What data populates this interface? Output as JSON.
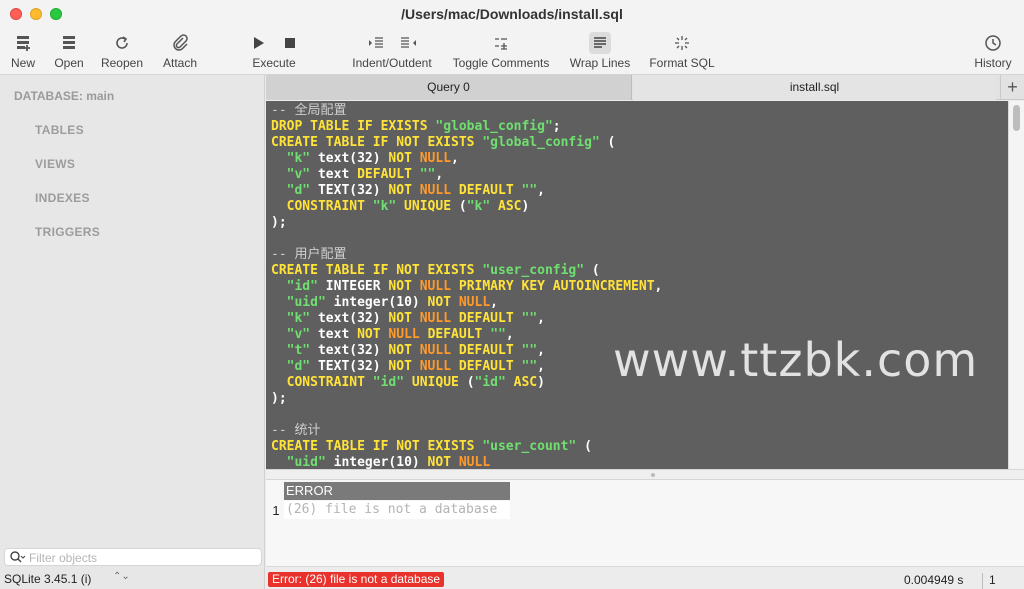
{
  "window": {
    "title": "/Users/mac/Downloads/install.sql"
  },
  "toolbar": {
    "new": "New",
    "open": "Open",
    "reopen": "Reopen",
    "attach": "Attach",
    "execute": "Execute",
    "indent_outdent": "Indent/Outdent",
    "toggle_comments": "Toggle Comments",
    "wrap_lines": "Wrap Lines",
    "format_sql": "Format SQL",
    "history": "History"
  },
  "sidebar": {
    "database_label": "DATABASE: main",
    "items": [
      "TABLES",
      "VIEWS",
      "INDEXES",
      "TRIGGERS"
    ],
    "filter_placeholder": "Filter objects",
    "sqlite_version": "SQLite 3.45.1 (i)",
    "version_chevron": "⌃⌄"
  },
  "tabs": [
    "Query 0",
    "install.sql"
  ],
  "tab_add": "+",
  "editor": {
    "watermark": "www.ttzbk.com",
    "lines": [
      [
        [
          "c",
          "-- 全局配置"
        ]
      ],
      [
        [
          "k",
          "DROP TABLE IF EXISTS "
        ],
        [
          "s",
          "\"global_config\""
        ],
        [
          "p",
          ";"
        ]
      ],
      [
        [
          "k",
          "CREATE TABLE IF NOT EXISTS "
        ],
        [
          "s",
          "\"global_config\""
        ],
        [
          "p",
          " ("
        ]
      ],
      [
        [
          "p",
          "  "
        ],
        [
          "s",
          "\"k\""
        ],
        [
          "p",
          " text(32) "
        ],
        [
          "k",
          "NOT "
        ],
        [
          "n",
          "NULL"
        ],
        [
          "p",
          ","
        ]
      ],
      [
        [
          "p",
          "  "
        ],
        [
          "s",
          "\"v\""
        ],
        [
          "p",
          " text "
        ],
        [
          "k",
          "DEFAULT "
        ],
        [
          "s",
          "\"\""
        ],
        [
          "p",
          ","
        ]
      ],
      [
        [
          "p",
          "  "
        ],
        [
          "s",
          "\"d\""
        ],
        [
          "p",
          " TEXT(32) "
        ],
        [
          "k",
          "NOT "
        ],
        [
          "n",
          "NULL "
        ],
        [
          "k",
          "DEFAULT "
        ],
        [
          "s",
          "\"\""
        ],
        [
          "p",
          ","
        ]
      ],
      [
        [
          "p",
          "  "
        ],
        [
          "k",
          "CONSTRAINT "
        ],
        [
          "s",
          "\"k\""
        ],
        [
          "k",
          " UNIQUE "
        ],
        [
          "p",
          "("
        ],
        [
          "s",
          "\"k\""
        ],
        [
          "k",
          " ASC"
        ],
        [
          "p",
          ")"
        ]
      ],
      [
        [
          "p",
          ");"
        ]
      ],
      [
        [
          "p",
          ""
        ]
      ],
      [
        [
          "c",
          "-- 用户配置"
        ]
      ],
      [
        [
          "k",
          "CREATE TABLE IF NOT EXISTS "
        ],
        [
          "s",
          "\"user_config\""
        ],
        [
          "p",
          " ("
        ]
      ],
      [
        [
          "p",
          "  "
        ],
        [
          "s",
          "\"id\""
        ],
        [
          "p",
          " INTEGER "
        ],
        [
          "k",
          "NOT "
        ],
        [
          "n",
          "NULL "
        ],
        [
          "k",
          "PRIMARY KEY AUTOINCREMENT"
        ],
        [
          "p",
          ","
        ]
      ],
      [
        [
          "p",
          "  "
        ],
        [
          "s",
          "\"uid\""
        ],
        [
          "p",
          " integer(10) "
        ],
        [
          "k",
          "NOT "
        ],
        [
          "n",
          "NULL"
        ],
        [
          "p",
          ","
        ]
      ],
      [
        [
          "p",
          "  "
        ],
        [
          "s",
          "\"k\""
        ],
        [
          "p",
          " text(32) "
        ],
        [
          "k",
          "NOT "
        ],
        [
          "n",
          "NULL "
        ],
        [
          "k",
          "DEFAULT "
        ],
        [
          "s",
          "\"\""
        ],
        [
          "p",
          ","
        ]
      ],
      [
        [
          "p",
          "  "
        ],
        [
          "s",
          "\"v\""
        ],
        [
          "p",
          " text "
        ],
        [
          "k",
          "NOT "
        ],
        [
          "n",
          "NULL "
        ],
        [
          "k",
          "DEFAULT "
        ],
        [
          "s",
          "\"\""
        ],
        [
          "p",
          ","
        ]
      ],
      [
        [
          "p",
          "  "
        ],
        [
          "s",
          "\"t\""
        ],
        [
          "p",
          " text(32) "
        ],
        [
          "k",
          "NOT "
        ],
        [
          "n",
          "NULL "
        ],
        [
          "k",
          "DEFAULT "
        ],
        [
          "s",
          "\"\""
        ],
        [
          "p",
          ","
        ]
      ],
      [
        [
          "p",
          "  "
        ],
        [
          "s",
          "\"d\""
        ],
        [
          "p",
          " TEXT(32) "
        ],
        [
          "k",
          "NOT "
        ],
        [
          "n",
          "NULL "
        ],
        [
          "k",
          "DEFAULT "
        ],
        [
          "s",
          "\"\""
        ],
        [
          "p",
          ","
        ]
      ],
      [
        [
          "p",
          "  "
        ],
        [
          "k",
          "CONSTRAINT "
        ],
        [
          "s",
          "\"id\""
        ],
        [
          "k",
          " UNIQUE "
        ],
        [
          "p",
          "("
        ],
        [
          "s",
          "\"id\""
        ],
        [
          "k",
          " ASC"
        ],
        [
          "p",
          ")"
        ]
      ],
      [
        [
          "p",
          ");"
        ]
      ],
      [
        [
          "p",
          ""
        ]
      ],
      [
        [
          "c",
          "-- 统计"
        ]
      ],
      [
        [
          "k",
          "CREATE TABLE IF NOT EXISTS "
        ],
        [
          "s",
          "\"user_count\""
        ],
        [
          "p",
          " ("
        ]
      ],
      [
        [
          "p",
          "  "
        ],
        [
          "s",
          "\"uid\""
        ],
        [
          "p",
          " integer(10) "
        ],
        [
          "k",
          "NOT "
        ],
        [
          "n",
          "NULL"
        ]
      ]
    ]
  },
  "results": {
    "column": "ERROR",
    "row_number": "1",
    "value": "(26) file is not a database"
  },
  "status": {
    "error": "Error: (26) file is not a database",
    "elapsed": "0.004949 s",
    "rows": "1 rows"
  },
  "colors": {
    "editor_bg": "#5f5f5f",
    "keyword": "#ffe33a",
    "string": "#6fe06f",
    "null": "#ff9a2a",
    "error": "#e8322b"
  }
}
